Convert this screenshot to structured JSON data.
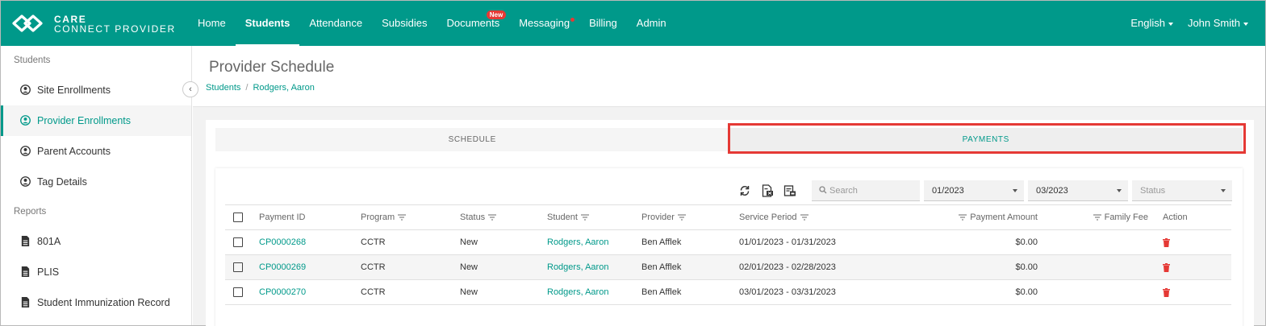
{
  "app": {
    "logo_line1": "CARE",
    "logo_line2": "CONNECT PROVIDER",
    "nav": [
      {
        "label": "Home"
      },
      {
        "label": "Students"
      },
      {
        "label": "Attendance"
      },
      {
        "label": "Subsidies"
      },
      {
        "label": "Documents",
        "badge": "New"
      },
      {
        "label": "Messaging"
      },
      {
        "label": "Billing"
      },
      {
        "label": "Admin"
      }
    ],
    "language": "English",
    "user": "John Smith",
    "accent_color": "#00998a",
    "alert_color": "#e53935"
  },
  "sidebar": {
    "section_students": "Students",
    "students_items": [
      {
        "label": "Site Enrollments",
        "icon": "user-circle-icon"
      },
      {
        "label": "Provider Enrollments",
        "icon": "user-circle-icon"
      },
      {
        "label": "Parent Accounts",
        "icon": "user-circle-icon"
      },
      {
        "label": "Tag Details",
        "icon": "user-circle-icon"
      }
    ],
    "section_reports": "Reports",
    "report_items": [
      {
        "label": "801A",
        "icon": "document-icon"
      },
      {
        "label": "PLIS",
        "icon": "document-icon"
      },
      {
        "label": "Student Immunization Record",
        "icon": "document-icon"
      }
    ],
    "collapse_glyph": "‹"
  },
  "page": {
    "title": "Provider Schedule",
    "breadcrumb": {
      "root": "Students",
      "sep": "/",
      "current": "Rodgers, Aaron"
    },
    "tabs": [
      {
        "label": "SCHEDULE"
      },
      {
        "label": "PAYMENTS"
      }
    ]
  },
  "filters": {
    "search_placeholder": "Search",
    "from": "01/2023",
    "to": "03/2023",
    "status_placeholder": "Status"
  },
  "table": {
    "headers": {
      "payment_id": "Payment ID",
      "program": "Program",
      "status": "Status",
      "student": "Student",
      "provider": "Provider",
      "service_period": "Service Period",
      "payment_amount": "Payment Amount",
      "family_fee": "Family Fee",
      "action": "Action"
    },
    "rows": [
      {
        "payment_id": "CP0000268",
        "program": "CCTR",
        "status": "New",
        "student": "Rodgers, Aaron",
        "provider": "Ben Afflek",
        "service_period": "01/01/2023 - 01/31/2023",
        "payment_amount": "$0.00",
        "family_fee": ""
      },
      {
        "payment_id": "CP0000269",
        "program": "CCTR",
        "status": "New",
        "student": "Rodgers, Aaron",
        "provider": "Ben Afflek",
        "service_period": "02/01/2023 - 02/28/2023",
        "payment_amount": "$0.00",
        "family_fee": ""
      },
      {
        "payment_id": "CP0000270",
        "program": "CCTR",
        "status": "New",
        "student": "Rodgers, Aaron",
        "provider": "Ben Afflek",
        "service_period": "03/01/2023 - 03/31/2023",
        "payment_amount": "$0.00",
        "family_fee": ""
      }
    ]
  }
}
